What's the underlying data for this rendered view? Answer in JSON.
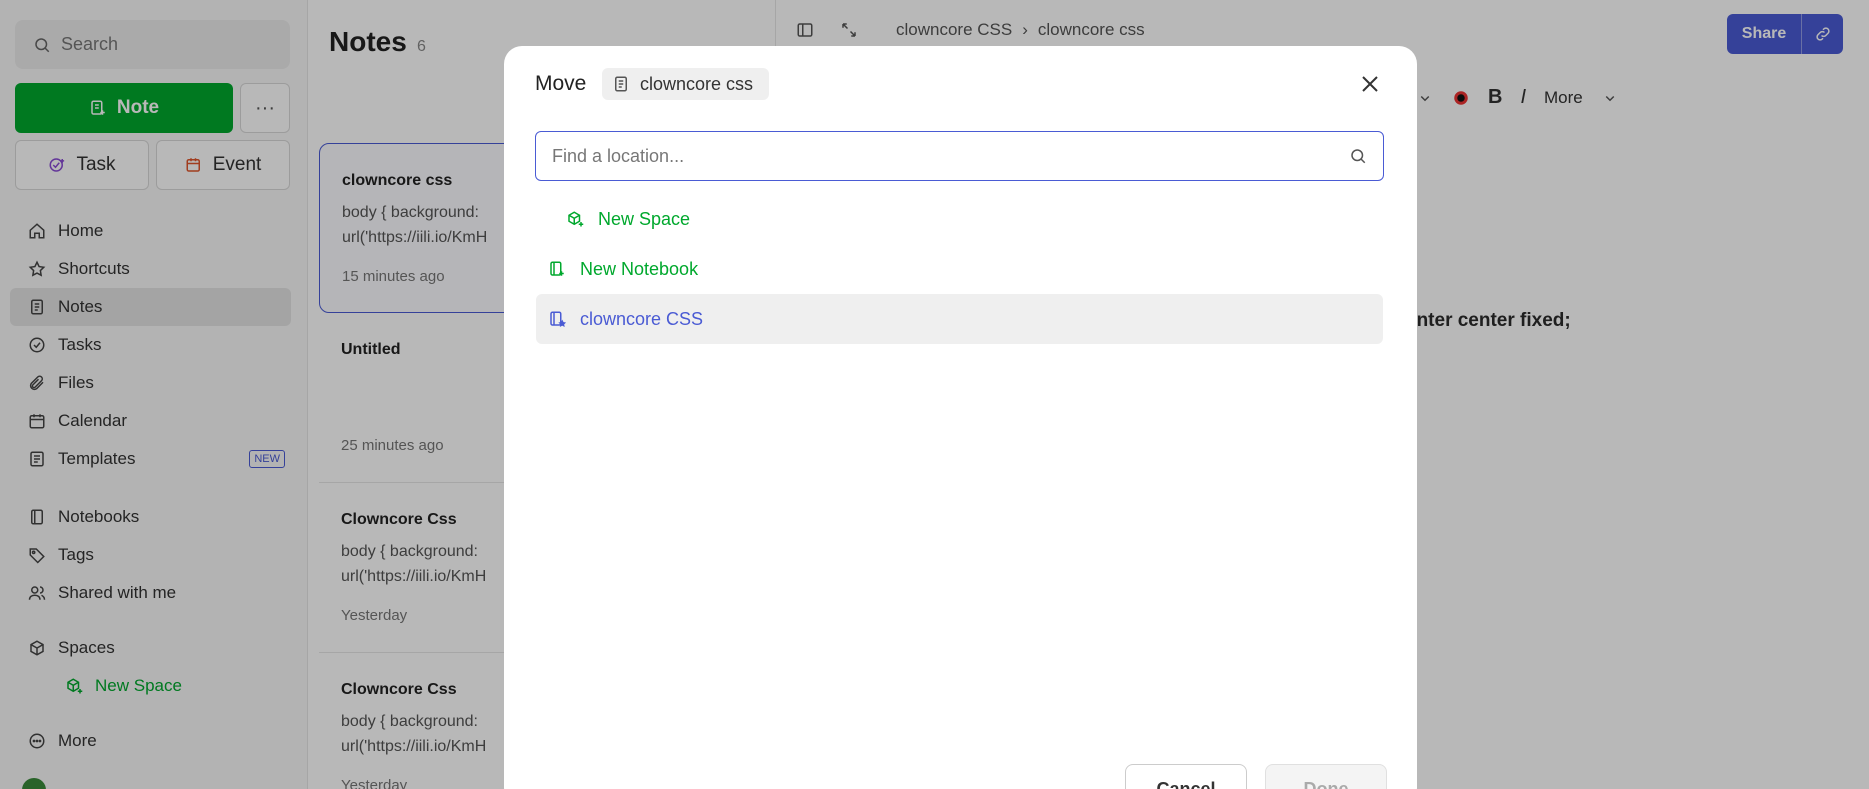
{
  "sidebar": {
    "search_placeholder": "Search",
    "note_label": "Note",
    "more_label": "···",
    "task_label": "Task",
    "event_label": "Event",
    "nav": [
      {
        "label": "Home"
      },
      {
        "label": "Shortcuts"
      },
      {
        "label": "Notes"
      },
      {
        "label": "Tasks"
      },
      {
        "label": "Files"
      },
      {
        "label": "Calendar"
      },
      {
        "label": "Templates",
        "badge": "NEW"
      }
    ],
    "nav2": [
      {
        "label": "Notebooks"
      },
      {
        "label": "Tags"
      },
      {
        "label": "Shared with me"
      }
    ],
    "spaces_label": "Spaces",
    "new_space_label": "New Space",
    "more_nav_label": "More"
  },
  "notes": {
    "title": "Notes",
    "count": "6",
    "items": [
      {
        "title": "clowncore css",
        "line1": "body { background:",
        "line2": "url('https://iili.io/KmH",
        "time": "15 minutes ago"
      },
      {
        "title": "Untitled",
        "line1": "",
        "line2": "",
        "time": "25 minutes ago"
      },
      {
        "title": "Clowncore Css",
        "line1": "body { background:",
        "line2": "url('https://iili.io/KmH",
        "time": "Yesterday"
      },
      {
        "title": "Clowncore Css",
        "line1": "body { background:",
        "line2": "url('https://iili.io/KmH",
        "time": "Yesterday"
      }
    ]
  },
  "editor": {
    "crumb1": "clowncore CSS",
    "crumb_sep": "›",
    "crumb2": "clowncore css",
    "share_label": "Share",
    "more_label": "More",
    "bold_label": "B",
    "italic_label": "I",
    "content_line": "enter center fixed;"
  },
  "modal": {
    "title": "Move",
    "chip_label": "clowncore css",
    "search_placeholder": "Find a location...",
    "rows": {
      "new_space": "New Space",
      "new_notebook": "New Notebook",
      "notebook": "clowncore CSS"
    },
    "cancel_label": "Cancel",
    "done_label": "Done"
  },
  "colors": {
    "brand_green": "#00a82d",
    "accent_blue": "#4a5bd4"
  }
}
